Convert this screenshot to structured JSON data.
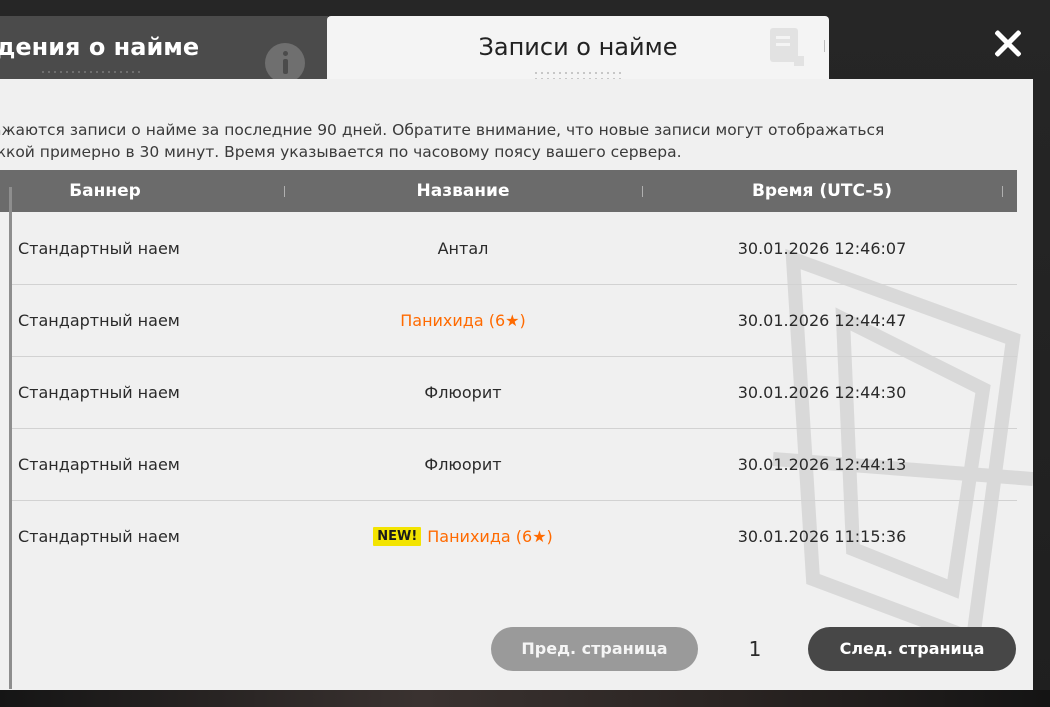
{
  "tabs": {
    "inactive": {
      "label": "дения о найме",
      "icon": "info-icon"
    },
    "active": {
      "label": "Записи о найме",
      "icon": "document-icon"
    }
  },
  "close": {
    "icon": "close-icon"
  },
  "info": {
    "line1": "ажаются записи о найме за последние 90 дней. Обратите внимание, что новые записи могут отображаться",
    "line2": "жкой примерно в 30 минут. Время указывается по часовому поясу вашего сервера."
  },
  "table": {
    "headers": [
      "Баннер",
      "Название",
      "Время (UTC-5)"
    ],
    "rows": [
      {
        "banner": "Стандартный наем",
        "name": "Антал",
        "rarity": "",
        "is_new": false,
        "time": "30.01.2026 12:46:07"
      },
      {
        "banner": "Стандартный наем",
        "name": "Панихида (6★)",
        "rarity": "6",
        "is_new": false,
        "time": "30.01.2026 12:44:47"
      },
      {
        "banner": "Стандартный наем",
        "name": "Флюорит",
        "rarity": "",
        "is_new": false,
        "time": "30.01.2026 12:44:30"
      },
      {
        "banner": "Стандартный наем",
        "name": "Флюорит",
        "rarity": "",
        "is_new": false,
        "time": "30.01.2026 12:44:13"
      },
      {
        "banner": "Стандартный наем",
        "name": "Панихида (6★)",
        "rarity": "6",
        "is_new": true,
        "new_label": "NEW!",
        "time": "30.01.2026 11:15:36"
      }
    ]
  },
  "pagination": {
    "prev_label": "Пред. страница",
    "page": "1",
    "next_label": "След. страница"
  },
  "colors": {
    "rare_text": "#ff6a00",
    "new_badge": "#f3e400",
    "header_bg": "#6b6b6b",
    "panel_bg": "#f0f0f0"
  }
}
